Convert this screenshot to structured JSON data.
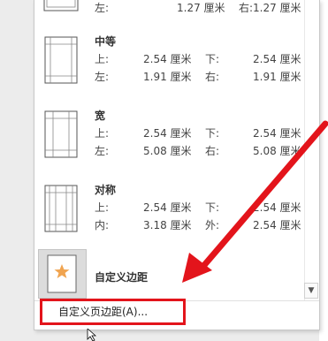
{
  "top_partial": {
    "left_label": "左:",
    "left_value": "1.27 厘米",
    "right_label": "右:",
    "right_value": "1.27 厘米"
  },
  "presets": [
    {
      "name": "中等",
      "rows": [
        [
          "上:",
          "2.54 厘米",
          "下:",
          "2.54 厘米"
        ],
        [
          "左:",
          "1.91 厘米",
          "右:",
          "1.91 厘米"
        ]
      ]
    },
    {
      "name": "宽",
      "rows": [
        [
          "上:",
          "2.54 厘米",
          "下:",
          "2.54 厘米"
        ],
        [
          "左:",
          "5.08 厘米",
          "右:",
          "5.08 厘米"
        ]
      ]
    },
    {
      "name": "对称",
      "rows": [
        [
          "上:",
          "2.54 厘米",
          "下:",
          "2.54 厘米"
        ],
        [
          "内:",
          "3.18 厘米",
          "外:",
          "2.54 厘米"
        ]
      ]
    }
  ],
  "custom_preset_name": "自定义边距",
  "custom_margins_button": "自定义页边距(A)...",
  "colors": {
    "highlight_red": "#e3141b",
    "star": "#f0a450"
  },
  "icons": {
    "star": "star-icon",
    "scroll_down": "chevron-down-icon"
  }
}
